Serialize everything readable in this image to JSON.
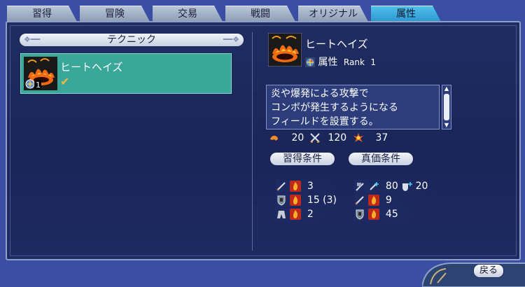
{
  "tabs": [
    {
      "label": "習得",
      "active": false
    },
    {
      "label": "冒険",
      "active": false
    },
    {
      "label": "交易",
      "active": false
    },
    {
      "label": "戦闘",
      "active": false
    },
    {
      "label": "オリジナル",
      "active": false
    },
    {
      "label": "属性",
      "active": true
    }
  ],
  "left_panel": {
    "header": "テクニック",
    "items": [
      {
        "name": "ヒートヘイズ",
        "level": "1",
        "learned": true
      }
    ]
  },
  "detail": {
    "name": "ヒートヘイズ",
    "attribute_label": "属性",
    "rank_label": "Rank",
    "rank_value": "1",
    "description": [
      "炎や爆発による攻撃で",
      "コンボが発生するようになる",
      "フィールドを設置する。"
    ],
    "stats": [
      {
        "icon": "arm-icon",
        "value": "20"
      },
      {
        "icon": "crossed-swords-icon",
        "value": "120"
      },
      {
        "icon": "explosion-icon",
        "value": "37"
      }
    ]
  },
  "conditions": {
    "learn_label": "習得条件",
    "true_label": "真価条件",
    "learn": [
      {
        "icon": "sword-icon",
        "value": "3"
      },
      {
        "icon": "shield-icon",
        "value": "15 (3)"
      },
      {
        "icon": "armor-icon",
        "value": "2"
      }
    ],
    "true_value": {
      "row1": [
        {
          "icon": "flag-icon",
          "value": ""
        },
        {
          "icon": "sword-up-icon",
          "value": "80"
        },
        {
          "icon": "shield-up-icon",
          "value": "20"
        }
      ],
      "row2": {
        "icon": "sword-icon",
        "value": "9"
      },
      "row3": {
        "icon": "shield-icon",
        "value": "45"
      }
    }
  },
  "back_button": "戻る",
  "colors": {
    "accent": "#3aa79b",
    "fire": "#f06a14",
    "panel": "#1f2d62",
    "tab_active": "#3ea9dc"
  }
}
